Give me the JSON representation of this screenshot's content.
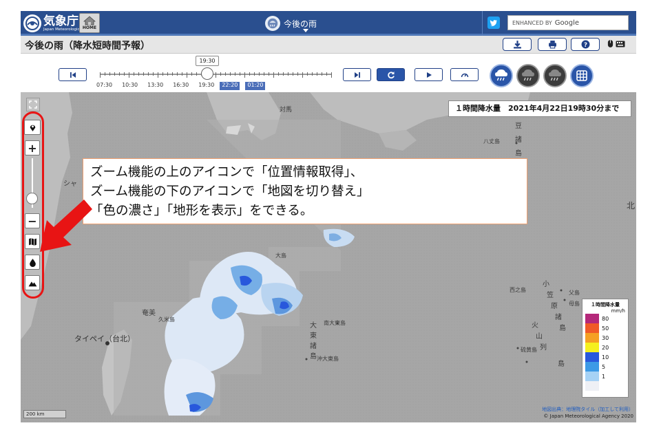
{
  "header": {
    "agency_name": "気象庁",
    "agency_name_en": "Japan Meteorological Agency",
    "home_label": "HOME",
    "center_title": "今後の雨",
    "search_placeholder": "ENHANCED BY",
    "search_brand": "Google"
  },
  "titlebar": {
    "page_title": "今後の雨（降水短時間予報）"
  },
  "timeline": {
    "current_time": "19:30",
    "labels": [
      "07:30",
      "10:30",
      "13:30",
      "16:30",
      "19:30"
    ],
    "forecast_labels": [
      "22:20",
      "01:20"
    ]
  },
  "map": {
    "obs_title": "１時間降水量　2021年4月22日19時30分まで",
    "callout_lines": [
      "ズーム機能の上のアイコンで「位置情報取得」、",
      "ズーム機能の下のアイコンで「地図を切り替え」",
      "「色の濃さ」「地形を表示」をできる。"
    ],
    "zoom_in": "+",
    "zoom_out": "−",
    "scale": "200 km",
    "credit_source": "地図出典：地理院タイル（加工して利用）",
    "credit_copyright": "© Japan Meteorological Agency 2020",
    "place_labels": {
      "hachijojima": "八丈島",
      "nishinoshima": "西之島",
      "chichijima": "父島",
      "hahajima": "母島",
      "iwoto": "硫黄島",
      "minamidaito": "南大東島",
      "okidaito": "沖大東島",
      "taipei": "タイペイ（台北）",
      "kumejima": "久米島",
      "amami": "奄美",
      "oshima": "大島",
      "daito_labels": [
        "大",
        "東",
        "諸",
        "島"
      ],
      "izu_labels": [
        "豆",
        "諸",
        "島"
      ],
      "ogasawara_labels": [
        "小",
        "笠",
        "原",
        "諸",
        "島"
      ],
      "kazan_labels": [
        "火",
        "山",
        "列",
        "島"
      ],
      "north_edge": "北",
      "left_edge": "シャ",
      "tsushima": "対馬"
    },
    "legend": {
      "title": "１時間降水量",
      "unit": "mm/h",
      "items": [
        {
          "value": "80",
          "color": "#b4287a"
        },
        {
          "value": "50",
          "color": "#f05a28"
        },
        {
          "value": "30",
          "color": "#f5a023"
        },
        {
          "value": "20",
          "color": "#f5f01e"
        },
        {
          "value": "10",
          "color": "#2858dc"
        },
        {
          "value": "5",
          "color": "#3c9ae6"
        },
        {
          "value": "1",
          "color": "#a6d2f5"
        },
        {
          "value": "",
          "color": "#eef0f5"
        }
      ]
    }
  },
  "colors": {
    "header_blue": "#2a4f8f",
    "button_blue": "#1f3f86",
    "annotation_red": "#e81414"
  }
}
